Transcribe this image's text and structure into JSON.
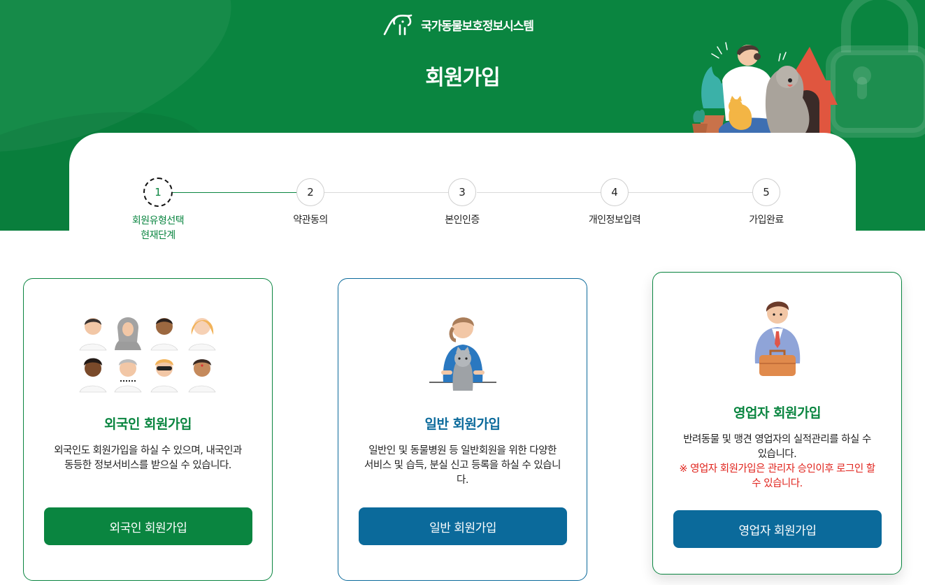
{
  "header": {
    "brand_name": "국가동물보호정보시스템",
    "page_title": "회원가입"
  },
  "steps": [
    {
      "number": "1",
      "label": "회원유형선택",
      "sublabel": "현재단계",
      "active": true
    },
    {
      "number": "2",
      "label": "약관동의"
    },
    {
      "number": "3",
      "label": "본인인증"
    },
    {
      "number": "4",
      "label": "개인정보입력"
    },
    {
      "number": "5",
      "label": "가입완료"
    }
  ],
  "cards": {
    "foreign": {
      "title": "외국인 회원가입",
      "desc": "외국인도 회원가입을 하실 수 있으며, 내국인과 동등한 정보서비스를 받으실 수 있습니다.",
      "button": "외국인 회원가입"
    },
    "general": {
      "title": "일반 회원가입",
      "desc": "일반인 및 동물병원 등 일반회원을 위한 다양한 서비스 및 습득, 분실 신고 등록을 하실 수 있습니다.",
      "button": "일반 회원가입"
    },
    "business": {
      "title": "영업자 회원가입",
      "desc": "반려동물 및 맹견 영업자의 실적관리를 하실 수 있습니다.",
      "note": "※ 영업자 회원가입은 관리자 승인이후 로그인 할 수 있습니다.",
      "button": "영업자 회원가입"
    }
  },
  "colors": {
    "brand_green": "#0a8540",
    "brand_blue": "#0b6a9b",
    "note_red": "#e0221b"
  },
  "icons": [
    "brand-logo-icon",
    "lock-icon",
    "people-group-icon",
    "person-with-cat-icon",
    "businessman-icon"
  ]
}
